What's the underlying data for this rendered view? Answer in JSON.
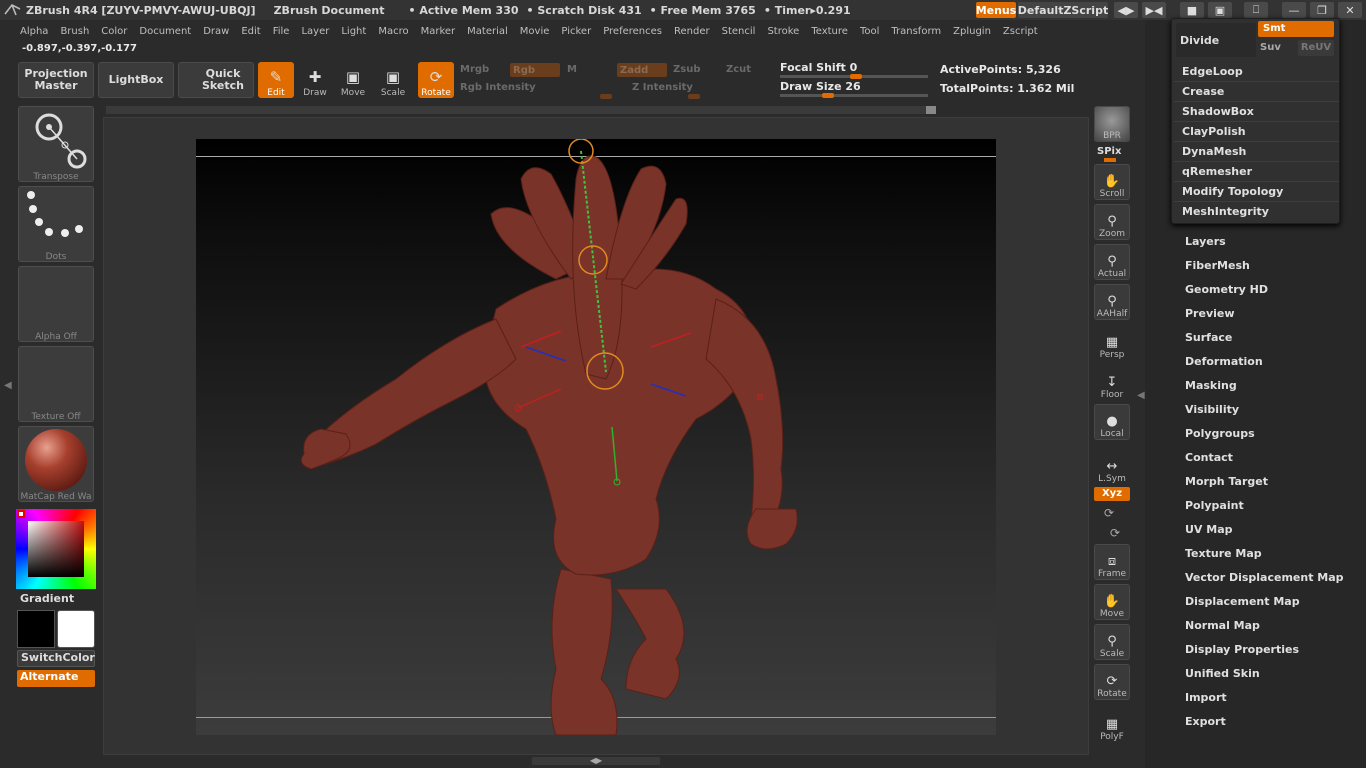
{
  "title_bar": {
    "app": "ZBrush 4R4 [ZUYV-PMVY-AWUJ-UBQJ]",
    "document": "ZBrush Document",
    "active_mem": "• Active Mem 330",
    "scratch_disk": "• Scratch Disk 431",
    "free_mem": "• Free Mem 3765",
    "timer": "• Timer▸0.291",
    "menus_btn": "Menus",
    "script_btn": "DefaultZScript"
  },
  "menu_bar": [
    "Alpha",
    "Brush",
    "Color",
    "Document",
    "Draw",
    "Edit",
    "File",
    "Layer",
    "Light",
    "Macro",
    "Marker",
    "Material",
    "Movie",
    "Picker",
    "Preferences",
    "Render",
    "Stencil",
    "Stroke",
    "Texture",
    "Tool",
    "Transform",
    "Zplugin",
    "Zscript"
  ],
  "coords": "-0.897,-0.397,-0.177",
  "toolbar": {
    "projection_master": "Projection Master",
    "lightbox": "LightBox",
    "quick_sketch": "Quick Sketch",
    "edit": "Edit",
    "draw": "Draw",
    "move": "Move",
    "scale": "Scale",
    "rotate": "Rotate",
    "mrgb": "Mrgb",
    "rgb": "Rgb",
    "m": "M",
    "zadd": "Zadd",
    "zsub": "Zsub",
    "zcut": "Zcut",
    "rgb_intensity": "Rgb Intensity",
    "z_intensity": "Z Intensity",
    "focal_shift_label": "Focal Shift",
    "focal_shift_value": "0",
    "draw_size_label": "Draw Size",
    "draw_size_value": "26",
    "active_points": "ActivePoints: 5,326",
    "total_points": "TotalPoints: 1.362 Mil"
  },
  "left_shelf": {
    "transpose": "Transpose",
    "dots": "Dots",
    "alpha_off": "Alpha  Off",
    "texture_off": "Texture  Off",
    "matcap": "MatCap  Red  Wa",
    "gradient": "Gradient",
    "switch_color": "SwitchColor",
    "alternate": "Alternate"
  },
  "right_shelf": {
    "bpr": "BPR",
    "spix": "SPix",
    "scroll": "Scroll",
    "zoom": "Zoom",
    "actual": "Actual",
    "aahalf": "AAHalf",
    "persp": "Persp",
    "floor": "Floor",
    "local": "Local",
    "lsym": "L.Sym",
    "xyz": "Xyz",
    "frame": "Frame",
    "move": "Move",
    "scale": "Scale",
    "rotate": "Rotate",
    "polyf": "PolyF"
  },
  "subpanel": {
    "divide": "Divide",
    "smt": "Smt",
    "suv": "Suv",
    "reuv": "ReUV",
    "items": [
      "EdgeLoop",
      "Crease",
      "ShadowBox",
      "ClayPolish",
      "DynaMesh",
      "qRemesher",
      "Modify Topology",
      "MeshIntegrity"
    ]
  },
  "tool_palette": [
    "Layers",
    "FiberMesh",
    "Geometry HD",
    "Preview",
    "Surface",
    "Deformation",
    "Masking",
    "Visibility",
    "Polygroups",
    "Contact",
    "Morph Target",
    "Polypaint",
    "UV Map",
    "Texture Map",
    "Vector Displacement Map",
    "Displacement Map",
    "Normal Map",
    "Display Properties",
    "Unified Skin",
    "Import",
    "Export"
  ],
  "colors": {
    "accent": "#e06c00",
    "model": "#7a3328"
  }
}
